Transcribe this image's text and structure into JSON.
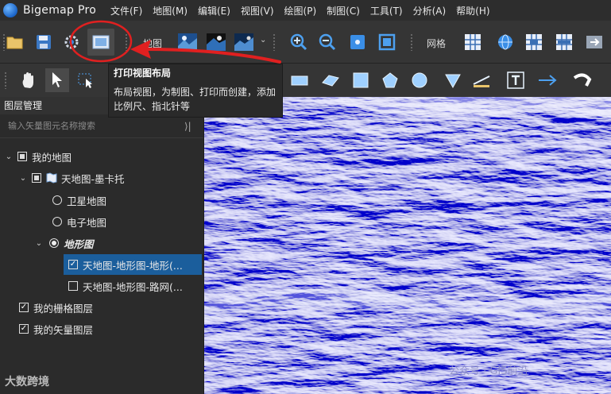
{
  "app": {
    "title": "Bigemap Pro"
  },
  "menu": [
    "文件(F)",
    "地图(M)",
    "编辑(E)",
    "视图(V)",
    "绘图(P)",
    "制图(C)",
    "工具(T)",
    "分析(A)",
    "帮助(H)"
  ],
  "toolbar": {
    "map_label": "地图",
    "grid_label": "网格"
  },
  "tooltip": {
    "title": "打印视图布局",
    "body": "布局视图，为制图、打印而创建，添加比例尺、指北针等"
  },
  "layer_panel": {
    "header": "图层管理",
    "search_placeholder": "输入矢量图元名称搜索",
    "tree": {
      "root": "我的地图",
      "group": "天地图-墨卡托",
      "satellite": "卫星地图",
      "electronic": "电子地图",
      "terrain": "地形图",
      "terrain_layer": "天地图-地形图-地形(...",
      "road_layer": "天地图-地形图-路网(...",
      "raster": "我的栅格图层",
      "vector": "我的矢量图层"
    }
  },
  "watermarks": {
    "left": "大数跨境",
    "right": "公众号 · GIS前沿"
  },
  "colors": {
    "selection": "#1b5e9c",
    "annotation_red": "#e02020",
    "accent_blue": "#3a8ee6"
  }
}
